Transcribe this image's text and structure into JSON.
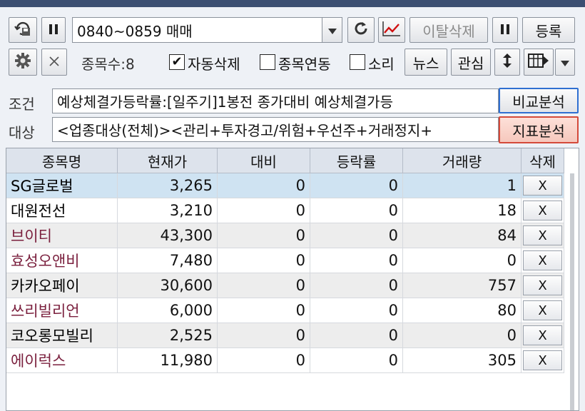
{
  "toolbar1": {
    "icon_left": "search-save-icon",
    "pause_icon": "pause-icon",
    "condition_select": "0840~0859 매매",
    "dropdown_icon": "triangle-down-icon",
    "refresh_icon": "refresh-icon",
    "chart_icon": "line-chart-icon",
    "exit_delete_label": "이탈삭제",
    "pause2_icon": "pause-icon",
    "register_label": "등록"
  },
  "toolbar2": {
    "settings_icon": "gear-icon",
    "close_icon": "close-icon",
    "count_label": "종목수:8",
    "auto_delete": {
      "label": "자동삭제",
      "checked": true
    },
    "stock_link": {
      "label": "종목연동",
      "checked": false
    },
    "sound": {
      "label": "소리",
      "checked": false
    },
    "news_label": "뉴스",
    "watch_label": "관심",
    "updown_icon": "up-down-arrow-icon",
    "columns_icon": "columns-arrow-icon",
    "menu_icon": "triangle-down-icon"
  },
  "condition": {
    "label": "조건",
    "value": "예상체결가등락률:[일주기]1봉전 종가대비 예상체결가등",
    "compare_button": "비교분석"
  },
  "target": {
    "label": "대상",
    "value": "<업종대상(전체)><관리+투자경고/위험+우선주+거래정지+",
    "indicator_button": "지표분석"
  },
  "table": {
    "headers": [
      "종목명",
      "현재가",
      "대비",
      "등락률",
      "거래량",
      "삭제"
    ],
    "rows": [
      {
        "name": "SG글로벌",
        "price": "3,265",
        "change": "0",
        "rate": "0",
        "volume": "1",
        "del": "X",
        "color": "#000000",
        "selected": true
      },
      {
        "name": "대원전선",
        "price": "3,210",
        "change": "0",
        "rate": "0",
        "volume": "18",
        "del": "X",
        "color": "#000000",
        "selected": false
      },
      {
        "name": "브이티",
        "price": "43,300",
        "change": "0",
        "rate": "0",
        "volume": "84",
        "del": "X",
        "color": "#7a1f3d",
        "selected": false
      },
      {
        "name": "효성오앤비",
        "price": "7,480",
        "change": "0",
        "rate": "0",
        "volume": "0",
        "del": "X",
        "color": "#7a1f3d",
        "selected": false
      },
      {
        "name": "카카오페이",
        "price": "30,600",
        "change": "0",
        "rate": "0",
        "volume": "757",
        "del": "X",
        "color": "#000000",
        "selected": false
      },
      {
        "name": "쓰리빌리언",
        "price": "6,000",
        "change": "0",
        "rate": "0",
        "volume": "80",
        "del": "X",
        "color": "#7a1f3d",
        "selected": false
      },
      {
        "name": "코오롱모빌리",
        "price": "2,525",
        "change": "0",
        "rate": "0",
        "volume": "0",
        "del": "X",
        "color": "#000000",
        "selected": false
      },
      {
        "name": "에이럭스",
        "price": "11,980",
        "change": "0",
        "rate": "0",
        "volume": "305",
        "del": "X",
        "color": "#7a1f3d",
        "selected": false
      }
    ]
  },
  "colors": {
    "selected_row": "#cfe3f2",
    "alt_row": "#ededed",
    "normal_row": "#ffffff"
  }
}
